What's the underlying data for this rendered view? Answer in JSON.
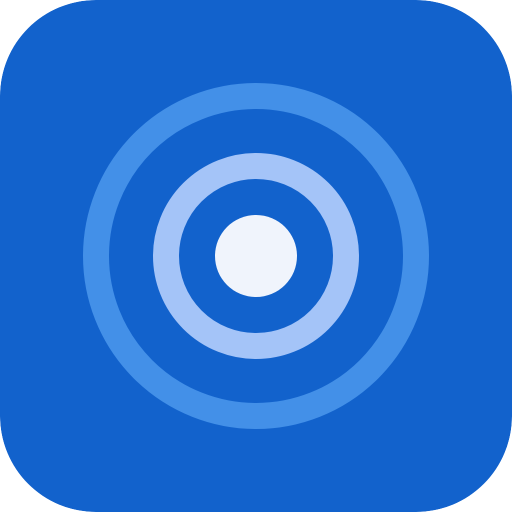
{
  "icon": {
    "name": "radar-target-icon",
    "colors": {
      "background": "#1262CC",
      "outer_ring": "#4390E8",
      "inner_ring": "#A4C4F8",
      "center_dot": "#F0F4FC"
    }
  }
}
